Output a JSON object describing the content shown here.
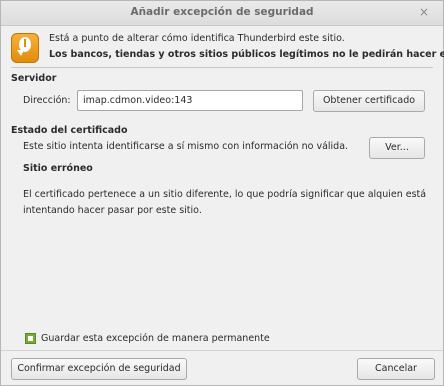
{
  "window": {
    "title": "Añadir excepción de seguridad",
    "close_symbol": "×"
  },
  "header": {
    "line1": "Está a punto de alterar cómo identifica Thunderbird este sitio.",
    "line2": "Los bancos, tiendas y otros sitios públicos legítimos no le pedirán hacer esto."
  },
  "server": {
    "section_label": "Servidor",
    "address_label": "Dirección:",
    "address_value": "imap.cdmon.video:143",
    "get_cert_button": "Obtener certificado"
  },
  "certificate_status": {
    "section_label": "Estado del certificado",
    "description": "Este sitio intenta identificarse a sí mismo con información no válida.",
    "view_button": "Ver...",
    "error_title": "Sitio erróneo",
    "error_line1": "El certificado pertenece a un sitio diferente, lo que podría significar que alquien está",
    "error_line2": "intentando hacer pasar por este sitio."
  },
  "permanent": {
    "label": "Guardar esta excepción de manera permanente",
    "checked": true
  },
  "footer": {
    "confirm_button": "Confirmar excepción de seguridad",
    "cancel_button": "Cancelar"
  }
}
